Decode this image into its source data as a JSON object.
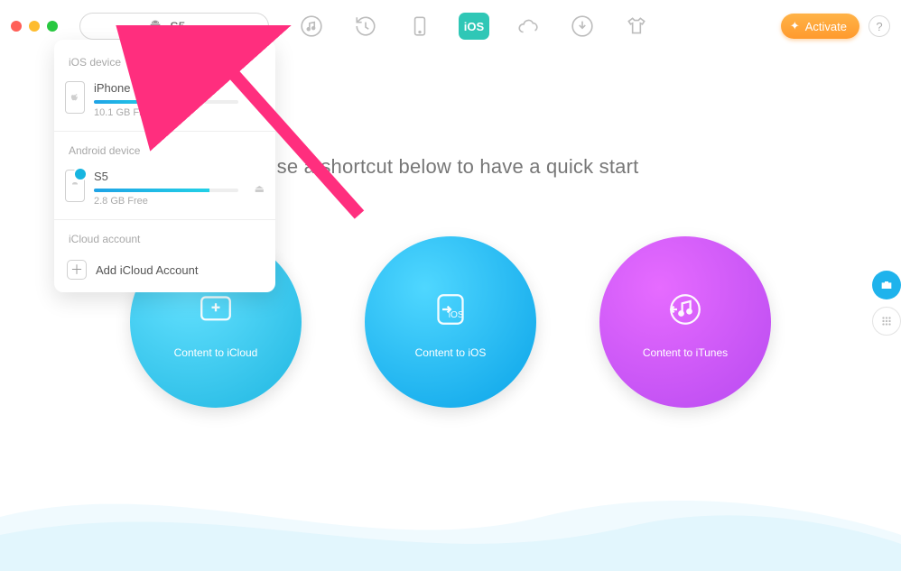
{
  "titlebar": {
    "device_selector": {
      "label": "S5"
    }
  },
  "activate": {
    "label": "Activate"
  },
  "dropdown": {
    "ios_section": "iOS device",
    "android_section": "Android device",
    "icloud_section": "iCloud account",
    "add_icloud": "Add iCloud Account",
    "devices": {
      "ios": [
        {
          "name": "iPhone (Сергей)",
          "free": "10.1 GB Free",
          "fill_pct": 45
        }
      ],
      "android": [
        {
          "name": "S5",
          "free": "2.8 GB Free",
          "fill_pct": 80
        }
      ]
    }
  },
  "main": {
    "prompt_prefix": "Use",
    "prompt_full": "Use a shortcut below to have a quick start"
  },
  "shortcuts": [
    {
      "label": "Content to iCloud"
    },
    {
      "label": "Content to iOS"
    },
    {
      "label": "Content to iTunes"
    }
  ]
}
